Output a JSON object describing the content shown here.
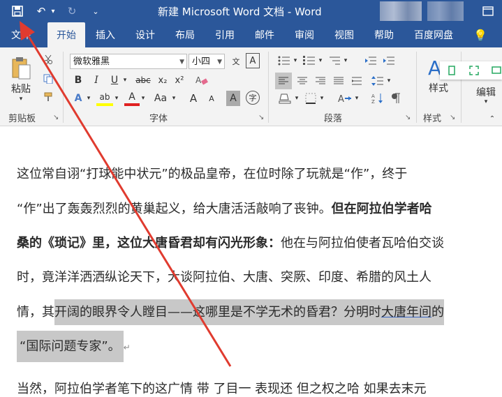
{
  "window": {
    "title": "新建 Microsoft Word 文档  -  Word"
  },
  "qat": {
    "save_icon": "save-icon",
    "undo_icon": "undo-icon",
    "redo_icon": "redo-icon",
    "customize_icon": "customize-qat-icon",
    "undo": "↶",
    "undo_dd": "▾",
    "redo": "↻",
    "more": "⌄"
  },
  "tabs": [
    {
      "label": "文件"
    },
    {
      "label": "开始"
    },
    {
      "label": "插入"
    },
    {
      "label": "设计"
    },
    {
      "label": "布局"
    },
    {
      "label": "引用"
    },
    {
      "label": "邮件"
    },
    {
      "label": "审阅"
    },
    {
      "label": "视图"
    },
    {
      "label": "帮助"
    },
    {
      "label": "百度网盘"
    }
  ],
  "tell_me_icon": "💡",
  "ribbon": {
    "clipboard": {
      "paste": "粘贴",
      "label": "剪贴板",
      "paste_dd": "▾"
    },
    "font": {
      "name": "微软雅黑",
      "size": "小四",
      "label": "字体",
      "wen": "文",
      "A_mark": "A",
      "bold": "B",
      "italic": "I",
      "underline": "U",
      "strike": "abc",
      "sub": "x₂",
      "sup": "x²",
      "ul_dd": "▾",
      "effects": "A",
      "highlight": "ab",
      "color": "A",
      "aa": "Aa",
      "grow": "A",
      "shrink": "A",
      "charshade": "A",
      "enclose": "字",
      "effects_dd": "▾",
      "hl_dd": "▾",
      "color_dd": "▾",
      "aa_dd": "▾"
    },
    "paragraph": {
      "label": "段落",
      "bullets": "☰",
      "numbering": "☰",
      "multilevel": "☰",
      "dd": "▾"
    },
    "styles": {
      "btn": "样式",
      "label": "样式"
    },
    "editing": {
      "btn": "编辑"
    }
  },
  "document": {
    "lines": [
      {
        "t1": "这位常自诩“打球能中状元”的极品皇帝，在位时除了玩就是“作”，终于"
      },
      {
        "t1": "“作”出了轰轰烈烈的黄巢起义，给大唐活活敲响了丧钟。",
        "t2": "但在阿拉伯学者哈"
      },
      {
        "t1": "桑的《琐记》里，这位大唐昏君却有闪光形象：",
        "t2": "他在与阿拉伯使者瓦哈伯交谈"
      },
      {
        "t1": "时，竟洋洋洒洒纵论天下，大谈阿拉伯、大唐、突厥、印度、希腊的风土人"
      },
      {
        "t1": "情，其",
        "t2": "开阔的眼界令人瞠目——这哪里是不学无术的昏君？分明时",
        "t3": "大唐年间",
        "t4": "的"
      },
      {
        "t1": "“国际问题专家”。",
        "mark": "↵"
      },
      {
        "t1": "当然，阿拉伯学者笔下的这广情  带  了目一  表现还  但之权之哈  如果去末元"
      }
    ]
  },
  "colors": {
    "title_bar": "#2b579a",
    "ribbon": "#f3f3f3",
    "selection": "#c8c8c8",
    "annotation_arrow": "#e03b2f"
  }
}
